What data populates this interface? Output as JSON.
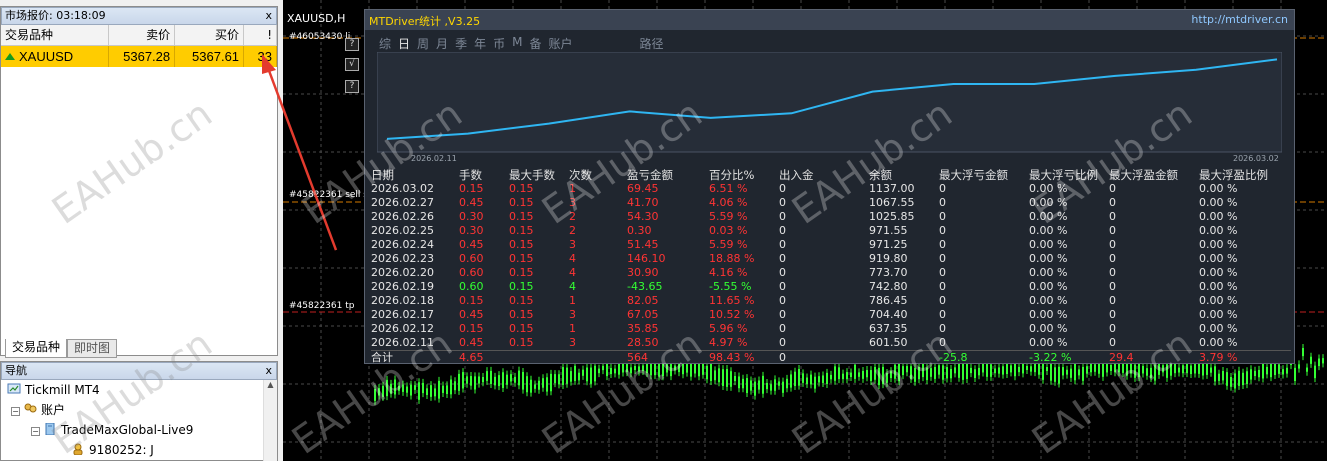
{
  "market_watch": {
    "title": "市场报价: 03:18:09",
    "close_glyph": "x",
    "headers": [
      "交易品种",
      "卖价",
      "买价",
      "!"
    ],
    "rows": [
      {
        "symbol": "XAUUSD",
        "bid": "5367.28",
        "ask": "5367.61",
        "spread": "33",
        "direction": "up"
      }
    ],
    "tabs": [
      "交易品种",
      "即时图"
    ]
  },
  "navigator": {
    "title": "导航",
    "close_glyph": "x",
    "tree": [
      {
        "label": "Tickmill MT4",
        "level": 0,
        "expander": ""
      },
      {
        "label": "账户",
        "level": 1,
        "expander": "−"
      },
      {
        "label": "TradeMaxGlobal-Live9",
        "level": 2,
        "expander": "−"
      },
      {
        "label": "9180252: J",
        "level": 3,
        "expander": ""
      }
    ]
  },
  "chart": {
    "title": "XAUUSD,H",
    "order_labels": [
      "#46053430 li",
      "#45822361 sell st",
      "#45822361 tp"
    ],
    "side_buttons": [
      "?",
      "√",
      "?"
    ]
  },
  "mtdriver": {
    "title": "MTDriver统计 ,V3.25",
    "url": "http://mtdriver.cn",
    "tabs": [
      {
        "label": "综",
        "active": false
      },
      {
        "label": "日",
        "active": true
      },
      {
        "label": "周",
        "active": false
      },
      {
        "label": "月",
        "active": false
      },
      {
        "label": "季",
        "active": false
      },
      {
        "label": "年",
        "active": false
      },
      {
        "label": "币",
        "active": false
      },
      {
        "label": "M",
        "active": false
      },
      {
        "label": "备",
        "active": false
      },
      {
        "label": "账户",
        "active": false
      },
      {
        "label": "路径",
        "active": false
      }
    ],
    "curve_start_date": "2026.02.11",
    "curve_end_date": "2026.03.02",
    "table_headers": [
      "日期",
      "手数",
      "最大手数",
      "次数",
      "盈亏金额",
      "百分比%",
      "出入金",
      "余额",
      "最大浮亏金额",
      "最大浮亏比例",
      "最大浮盈金额",
      "最大浮盈比例"
    ],
    "rows": [
      [
        "2026.03.02",
        "0.15",
        "0.15",
        "1",
        "69.45",
        "6.51 %",
        "0",
        "1137.00",
        "0",
        "0.00 %",
        "0",
        "0.00 %"
      ],
      [
        "2026.02.27",
        "0.45",
        "0.15",
        "3",
        "41.70",
        "4.06 %",
        "0",
        "1067.55",
        "0",
        "0.00 %",
        "0",
        "0.00 %"
      ],
      [
        "2026.02.26",
        "0.30",
        "0.15",
        "2",
        "54.30",
        "5.59 %",
        "0",
        "1025.85",
        "0",
        "0.00 %",
        "0",
        "0.00 %"
      ],
      [
        "2026.02.25",
        "0.30",
        "0.15",
        "2",
        "0.30",
        "0.03 %",
        "0",
        "971.55",
        "0",
        "0.00 %",
        "0",
        "0.00 %"
      ],
      [
        "2026.02.24",
        "0.45",
        "0.15",
        "3",
        "51.45",
        "5.59 %",
        "0",
        "971.25",
        "0",
        "0.00 %",
        "0",
        "0.00 %"
      ],
      [
        "2026.02.23",
        "0.60",
        "0.15",
        "4",
        "146.10",
        "18.88 %",
        "0",
        "919.80",
        "0",
        "0.00 %",
        "0",
        "0.00 %"
      ],
      [
        "2026.02.20",
        "0.60",
        "0.15",
        "4",
        "30.90",
        "4.16 %",
        "0",
        "773.70",
        "0",
        "0.00 %",
        "0",
        "0.00 %"
      ],
      [
        "2026.02.19",
        "0.60",
        "0.15",
        "4",
        "-43.65",
        "-5.55 %",
        "0",
        "742.80",
        "0",
        "0.00 %",
        "0",
        "0.00 %"
      ],
      [
        "2026.02.18",
        "0.15",
        "0.15",
        "1",
        "82.05",
        "11.65 %",
        "0",
        "786.45",
        "0",
        "0.00 %",
        "0",
        "0.00 %"
      ],
      [
        "2026.02.17",
        "0.45",
        "0.15",
        "3",
        "67.05",
        "10.52 %",
        "0",
        "704.40",
        "0",
        "0.00 %",
        "0",
        "0.00 %"
      ],
      [
        "2026.02.12",
        "0.15",
        "0.15",
        "1",
        "35.85",
        "5.96 %",
        "0",
        "637.35",
        "0",
        "0.00 %",
        "0",
        "0.00 %"
      ],
      [
        "2026.02.11",
        "0.45",
        "0.15",
        "3",
        "28.50",
        "4.97 %",
        "0",
        "601.50",
        "0",
        "0.00 %",
        "0",
        "0.00 %"
      ]
    ],
    "row_colors": [
      "red",
      "red",
      "red",
      "red",
      "red",
      "red",
      "red",
      "green",
      "red",
      "red",
      "red",
      "red"
    ],
    "total": [
      "合计",
      "4.65",
      "",
      "",
      "564",
      "98.43 %",
      "0",
      "",
      "-25.8",
      "-3.22 %",
      "29.4",
      "3.79 %"
    ],
    "balance_curve": [
      601.5,
      637.35,
      704.4,
      786.45,
      742.8,
      773.7,
      919.8,
      971.25,
      971.55,
      1025.85,
      1067.55,
      1137.0
    ],
    "curve_color": "#2fb6f2"
  },
  "watermark": "EAHub.cn",
  "colors": {
    "selected_row": "#ffcc00",
    "profit": "#ff3434",
    "loss_row": "#33ff33",
    "candle_up": "#33ff33",
    "annotation_arrow": "#e33b2e"
  }
}
